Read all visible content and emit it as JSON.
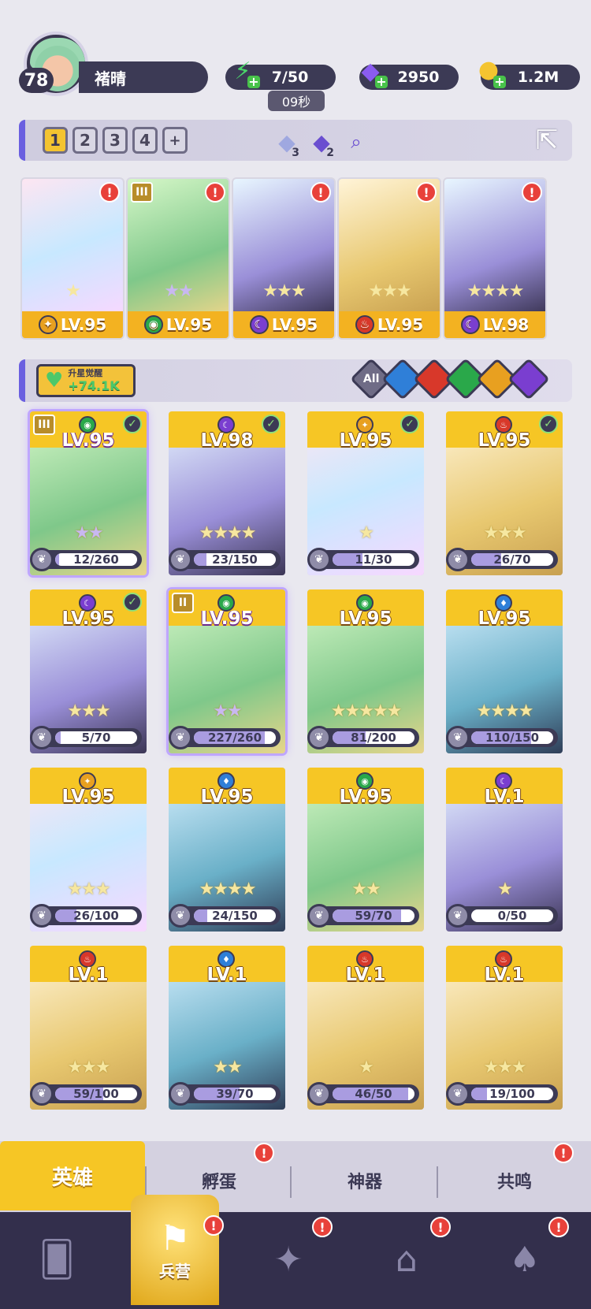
{
  "player": {
    "level": "78",
    "name": "褚晴"
  },
  "resources": {
    "energy": {
      "value": "7/50",
      "timer": "09秒",
      "icon": "lightning-icon",
      "color": "#4ad66a"
    },
    "gems": {
      "value": "2950",
      "icon": "diamond-icon",
      "color": "#8a5cf0"
    },
    "gold": {
      "value": "1.2M",
      "icon": "coin-icon",
      "color": "#f4c430"
    }
  },
  "team_bar": {
    "slots": [
      "1",
      "2",
      "3",
      "4"
    ],
    "add_slot": "+",
    "active_slot": 1,
    "items": [
      {
        "count": "3"
      },
      {
        "count": "2"
      }
    ]
  },
  "team": [
    {
      "level": "LV.95",
      "element": "light",
      "stars": 1,
      "star_color": "gold",
      "alert": "!",
      "rank": ""
    },
    {
      "level": "LV.95",
      "element": "wind",
      "stars": 2,
      "star_color": "purple",
      "alert": "!",
      "rank": "III"
    },
    {
      "level": "LV.95",
      "element": "dark",
      "stars": 3,
      "star_color": "gold",
      "alert": "!",
      "rank": ""
    },
    {
      "level": "LV.95",
      "element": "fire",
      "stars": 3,
      "star_color": "gold",
      "alert": "!",
      "rank": ""
    },
    {
      "level": "LV.98",
      "element": "dark",
      "stars": 4,
      "star_color": "gold",
      "alert": "!",
      "rank": ""
    }
  ],
  "awaken": {
    "label": "升星觉醒",
    "value": "+74.1K"
  },
  "filters": [
    {
      "label": "All",
      "color": "#6f6c86"
    },
    {
      "label": "",
      "color": "#2f7fd8"
    },
    {
      "label": "",
      "color": "#d8382a"
    },
    {
      "label": "",
      "color": "#2aa84a"
    },
    {
      "label": "",
      "color": "#e8a020"
    },
    {
      "label": "",
      "color": "#7a3ed0"
    }
  ],
  "element_colors": {
    "light": "#e8a020",
    "wind": "#2aa84a",
    "dark": "#7a3ed0",
    "fire": "#d8382a",
    "water": "#2f7fd8"
  },
  "heroes": [
    {
      "level": "LV.95",
      "element": "wind",
      "progress": "12/260",
      "fraction": 0.05,
      "stars": 2,
      "star_color": "purple",
      "checked": true,
      "rank": "III",
      "selected": true
    },
    {
      "level": "LV.98",
      "element": "dark",
      "progress": "23/150",
      "fraction": 0.15,
      "stars": 4,
      "star_color": "gold",
      "checked": true,
      "rank": "",
      "selected": false
    },
    {
      "level": "LV.95",
      "element": "light",
      "progress": "11/30",
      "fraction": 0.37,
      "stars": 1,
      "star_color": "gold",
      "checked": true,
      "rank": "",
      "selected": false
    },
    {
      "level": "LV.95",
      "element": "fire",
      "progress": "26/70",
      "fraction": 0.37,
      "stars": 3,
      "star_color": "gold",
      "checked": true,
      "rank": "",
      "selected": false
    },
    {
      "level": "LV.95",
      "element": "dark",
      "progress": "5/70",
      "fraction": 0.07,
      "stars": 3,
      "star_color": "gold",
      "checked": true,
      "rank": "",
      "selected": false
    },
    {
      "level": "LV.95",
      "element": "wind",
      "progress": "227/260",
      "fraction": 0.87,
      "stars": 2,
      "star_color": "purple",
      "checked": false,
      "rank": "II",
      "selected": true
    },
    {
      "level": "LV.95",
      "element": "wind",
      "progress": "81/200",
      "fraction": 0.4,
      "stars": 5,
      "star_color": "gold",
      "checked": false,
      "rank": "",
      "selected": false
    },
    {
      "level": "LV.95",
      "element": "water",
      "progress": "110/150",
      "fraction": 0.73,
      "stars": 4,
      "star_color": "gold",
      "checked": false,
      "rank": "",
      "selected": false
    },
    {
      "level": "LV.95",
      "element": "light",
      "progress": "26/100",
      "fraction": 0.26,
      "stars": 3,
      "star_color": "gold",
      "checked": false,
      "rank": "",
      "selected": false
    },
    {
      "level": "LV.95",
      "element": "water",
      "progress": "24/150",
      "fraction": 0.16,
      "stars": 4,
      "star_color": "gold",
      "checked": false,
      "rank": "",
      "selected": false
    },
    {
      "level": "LV.95",
      "element": "wind",
      "progress": "59/70",
      "fraction": 0.84,
      "stars": 2,
      "star_color": "gold",
      "checked": false,
      "rank": "",
      "selected": false
    },
    {
      "level": "LV.1",
      "element": "dark",
      "progress": "0/50",
      "fraction": 0,
      "stars": 1,
      "star_color": "gold",
      "checked": false,
      "rank": "",
      "selected": false
    },
    {
      "level": "LV.1",
      "element": "fire",
      "progress": "59/100",
      "fraction": 0.59,
      "stars": 3,
      "star_color": "gold",
      "checked": false,
      "rank": "",
      "selected": false
    },
    {
      "level": "LV.1",
      "element": "water",
      "progress": "39/70",
      "fraction": 0.56,
      "stars": 2,
      "star_color": "gold",
      "checked": false,
      "rank": "",
      "selected": false
    },
    {
      "level": "LV.1",
      "element": "fire",
      "progress": "46/50",
      "fraction": 0.92,
      "stars": 1,
      "star_color": "gold",
      "checked": false,
      "rank": "",
      "selected": false
    },
    {
      "level": "LV.1",
      "element": "fire",
      "progress": "19/100",
      "fraction": 0.19,
      "stars": 3,
      "star_color": "gold",
      "checked": false,
      "rank": "",
      "selected": false
    }
  ],
  "tabs": [
    {
      "label": "英雄",
      "active": true,
      "alert": ""
    },
    {
      "label": "孵蛋",
      "active": false,
      "alert": "!"
    },
    {
      "label": "神器",
      "active": false,
      "alert": ""
    },
    {
      "label": "共鸣",
      "active": false,
      "alert": "!"
    }
  ],
  "nav": [
    {
      "icon": "cards-icon",
      "label": "",
      "active": false,
      "alert": ""
    },
    {
      "icon": "barracks-icon",
      "label": "兵营",
      "active": true,
      "alert": "!"
    },
    {
      "icon": "map-book-icon",
      "label": "",
      "active": false,
      "alert": "!"
    },
    {
      "icon": "shrine-icon",
      "label": "",
      "active": false,
      "alert": "!"
    },
    {
      "icon": "mushroom-house-icon",
      "label": "",
      "active": false,
      "alert": "!"
    }
  ]
}
